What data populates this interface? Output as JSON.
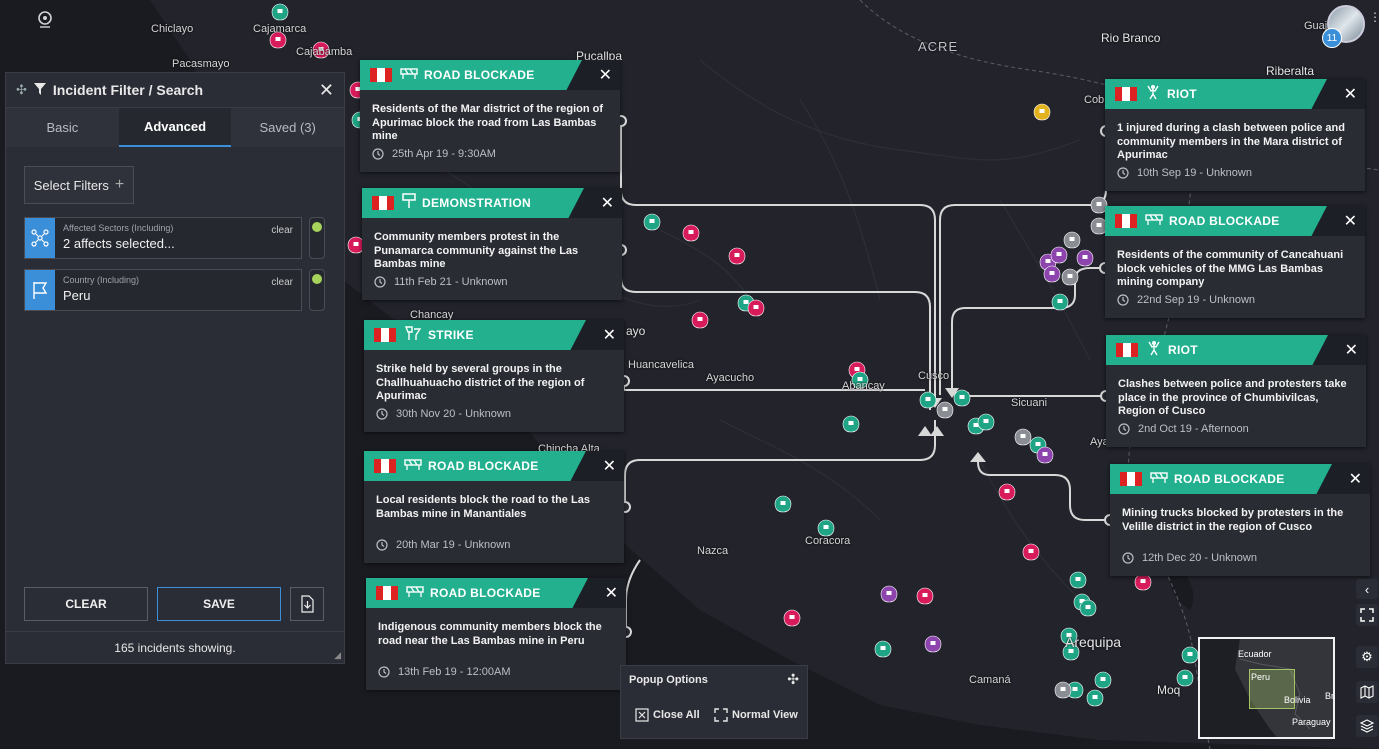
{
  "map_labels": {
    "chiclayo": "Chiclayo",
    "cajamarca": "Cajamarca",
    "cajabamba": "Cajabamba",
    "pacasmayo": "Pacasmayo",
    "pucallpa": "Pucallpa",
    "acre": "ACRE",
    "rio_branco": "Rio Branco",
    "riberalta": "Riberalta",
    "cobija": "Cob",
    "huancayo": "ayo",
    "huancavelica": "Huancavelica",
    "ayacucho": "Ayacucho",
    "chancay": "Chancay",
    "abancay": "Abancay",
    "cusco": "Cusco",
    "sicuani": "Sicuani",
    "ayaviri": "Aya",
    "chincha": "Chincha Alta",
    "nazca": "Nazca",
    "coracora": "Coracora",
    "arequipa": "Arequipa",
    "camana": "Camaná",
    "moquegua": "Moq",
    "guajara": "Guaja"
  },
  "filter_panel": {
    "title": "Incident Filter / Search",
    "tabs": [
      "Basic",
      "Advanced",
      "Saved (3)"
    ],
    "active_tab": "Advanced",
    "select_filters": "Select Filters",
    "filters": [
      {
        "label": "Affected Sectors (Including)",
        "value": "2 affects selected...",
        "clear": "clear"
      },
      {
        "label": "Country (Including)",
        "value": "Peru",
        "clear": "clear"
      }
    ],
    "clear_button": "CLEAR",
    "save_button": "SAVE",
    "status": "165 incidents showing."
  },
  "popups": [
    {
      "type": "ROAD BLOCKADE",
      "desc": "Residents of the Mar district of the region of Apurimac block the road from Las Bambas mine",
      "time": "25th Apr 19 - 9:30AM"
    },
    {
      "type": "DEMONSTRATION",
      "desc": "Community members protest in the Punamarca community against the Las Bambas mine",
      "time": "11th Feb 21 - Unknown"
    },
    {
      "type": "STRIKE",
      "desc": "Strike held by several groups in the Challhuahuacho district of the region of Apurimac",
      "time": "30th Nov 20 - Unknown"
    },
    {
      "type": "ROAD BLOCKADE",
      "desc": "Local residents block the road to the Las Bambas mine in Manantiales",
      "time": "20th Mar 19 - Unknown"
    },
    {
      "type": "ROAD BLOCKADE",
      "desc": "Indigenous community members block the road near the Las Bambas mine in Peru",
      "time": "13th Feb 19 - 12:00AM"
    },
    {
      "type": "RIOT",
      "desc": "1 injured during a clash between police and community members in the Mara district of Apurimac",
      "time": "10th Sep 19 - Unknown"
    },
    {
      "type": "ROAD BLOCKADE",
      "desc": "Residents of the community of Cancahuani block vehicles of the MMG Las Bambas mining company",
      "time": "22nd Sep 19 - Unknown"
    },
    {
      "type": "RIOT",
      "desc": "Clashes between police and protesters take place in the province of Chumbivilcas, Region of Cusco",
      "time": "2nd Oct 19 - Afternoon"
    },
    {
      "type": "ROAD BLOCKADE",
      "desc": "Mining trucks blocked by protesters in the Velille district in the region of Cusco",
      "time": "12th Dec 20 - Unknown"
    }
  ],
  "popup_options": {
    "title": "Popup Options",
    "close_all": "Close All",
    "normal_view": "Normal View"
  },
  "minimap": {
    "ecuador": "Ecuador",
    "peru": "Peru",
    "bolivia": "Bolivia",
    "paraguay": "Paraguay",
    "brazil": "Br"
  },
  "user": {
    "badge": "11"
  },
  "colors": {
    "accent": "#22b08e",
    "blue": "#3b8fd9",
    "marker_red": "#d81b5a",
    "marker_teal": "#1fa585",
    "marker_purple": "#8e44ad"
  }
}
